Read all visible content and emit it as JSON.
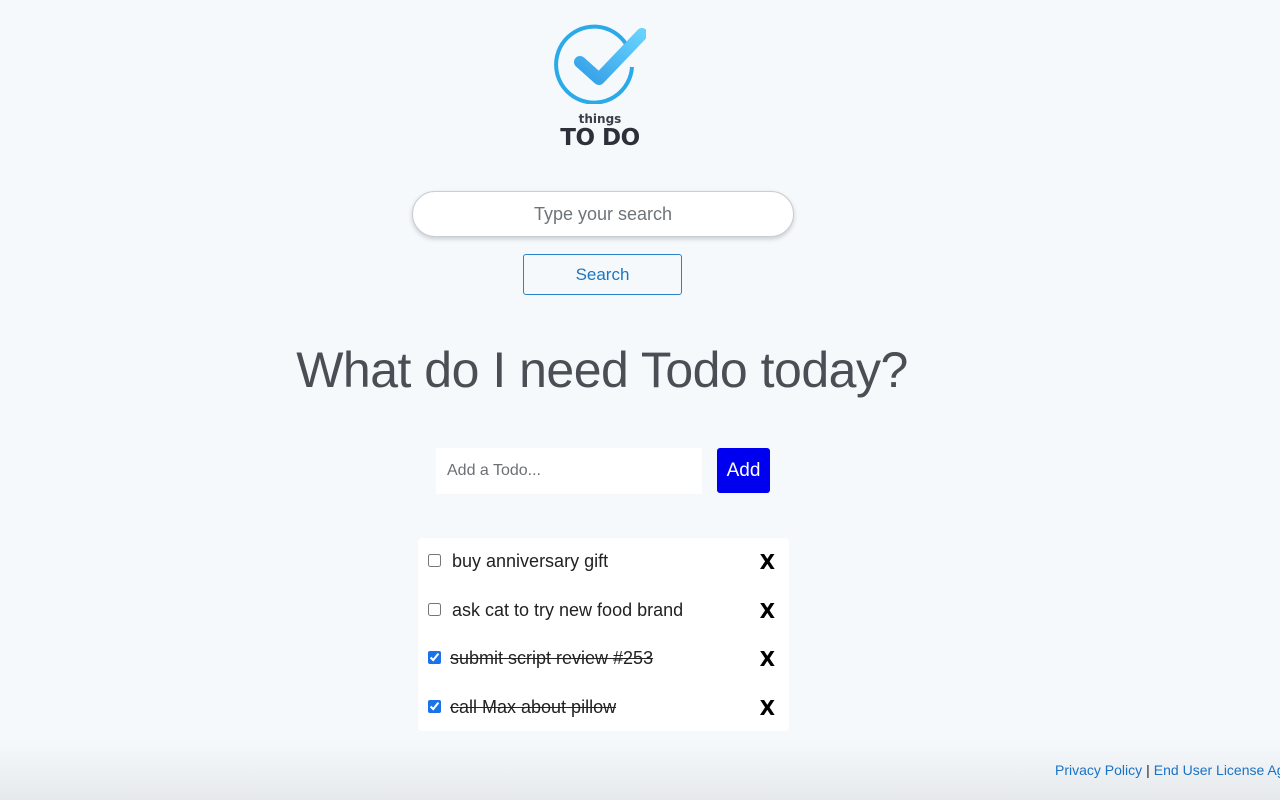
{
  "logo": {
    "small_text": "things",
    "big_text": "TO DO"
  },
  "search": {
    "placeholder": "Type your search",
    "value": "",
    "button_label": "Search"
  },
  "headline": "What do I need Todo today?",
  "add_todo": {
    "placeholder": "Add a Todo...",
    "value": "",
    "button_label": "Add"
  },
  "todos": [
    {
      "text": "buy anniversary gift",
      "done": false,
      "delete_label": "X"
    },
    {
      "text": "ask cat to try new food brand",
      "done": false,
      "delete_label": "X"
    },
    {
      "text": "submit script review #253",
      "done": true,
      "delete_label": "X"
    },
    {
      "text": "call Max about pillow",
      "done": true,
      "delete_label": "X"
    }
  ],
  "footer": {
    "privacy_label": "Privacy Policy",
    "separator": "|",
    "eula_label": "End User License Agreement"
  },
  "colors": {
    "background": "#f5f9fc",
    "accent_blue": "#1c76c1",
    "add_button": "#0000f0",
    "logo_blue": "#2aaae8"
  },
  "icons": {
    "logo": "checkmark-circle-icon",
    "delete": "close-x-icon"
  }
}
